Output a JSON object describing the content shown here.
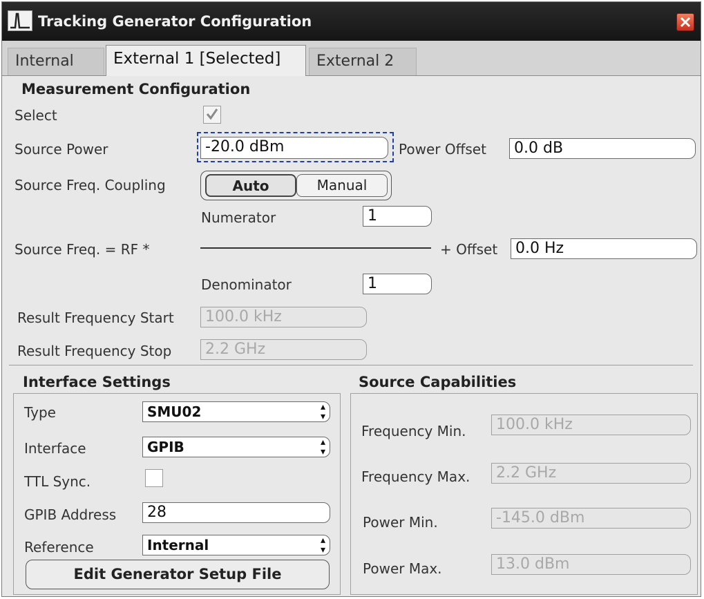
{
  "window": {
    "title": "Tracking Generator Configuration"
  },
  "tabs": [
    {
      "label": "Internal"
    },
    {
      "label": "External 1 [Selected]"
    },
    {
      "label": "External 2"
    }
  ],
  "measurement": {
    "section_title": "Measurement Configuration",
    "select_label": "Select",
    "select_checked": true,
    "source_power_label": "Source Power",
    "source_power_value": "-20.0 dBm",
    "power_offset_label": "Power Offset",
    "power_offset_value": "0.0 dB",
    "coupling_label": "Source Freq. Coupling",
    "coupling_options": [
      "Auto",
      "Manual"
    ],
    "coupling_selected": "Auto",
    "numerator_label": "Numerator",
    "numerator_value": "1",
    "formula_label": "Source Freq. = RF *",
    "offset_label": "+ Offset",
    "offset_value": "0.0 Hz",
    "denominator_label": "Denominator",
    "denominator_value": "1",
    "result_start_label": "Result Frequency Start",
    "result_start_value": "100.0 kHz",
    "result_stop_label": "Result Frequency Stop",
    "result_stop_value": "2.2 GHz"
  },
  "interface": {
    "section_title": "Interface Settings",
    "type_label": "Type",
    "type_value": "SMU02",
    "interface_label": "Interface",
    "interface_value": "GPIB",
    "ttl_label": "TTL Sync.",
    "ttl_checked": false,
    "gpib_label": "GPIB Address",
    "gpib_value": "28",
    "reference_label": "Reference",
    "reference_value": "Internal",
    "edit_button_label": "Edit Generator Setup File"
  },
  "capabilities": {
    "section_title": "Source Capabilities",
    "freq_min_label": "Frequency Min.",
    "freq_min_value": "100.0 kHz",
    "freq_max_label": "Frequency Max.",
    "freq_max_value": "2.2 GHz",
    "power_min_label": "Power Min.",
    "power_min_value": "-145.0 dBm",
    "power_max_label": "Power Max.",
    "power_max_value": "13.0 dBm"
  },
  "icons": {
    "app": "waveform-icon",
    "close": "close-icon",
    "check": "checkmark-icon",
    "select_arrows": "up-down-arrows-icon"
  },
  "colors": {
    "titlebar": "#1e1e1e",
    "close_button": "#d84a30",
    "focus_outline": "#1f3fa8"
  }
}
